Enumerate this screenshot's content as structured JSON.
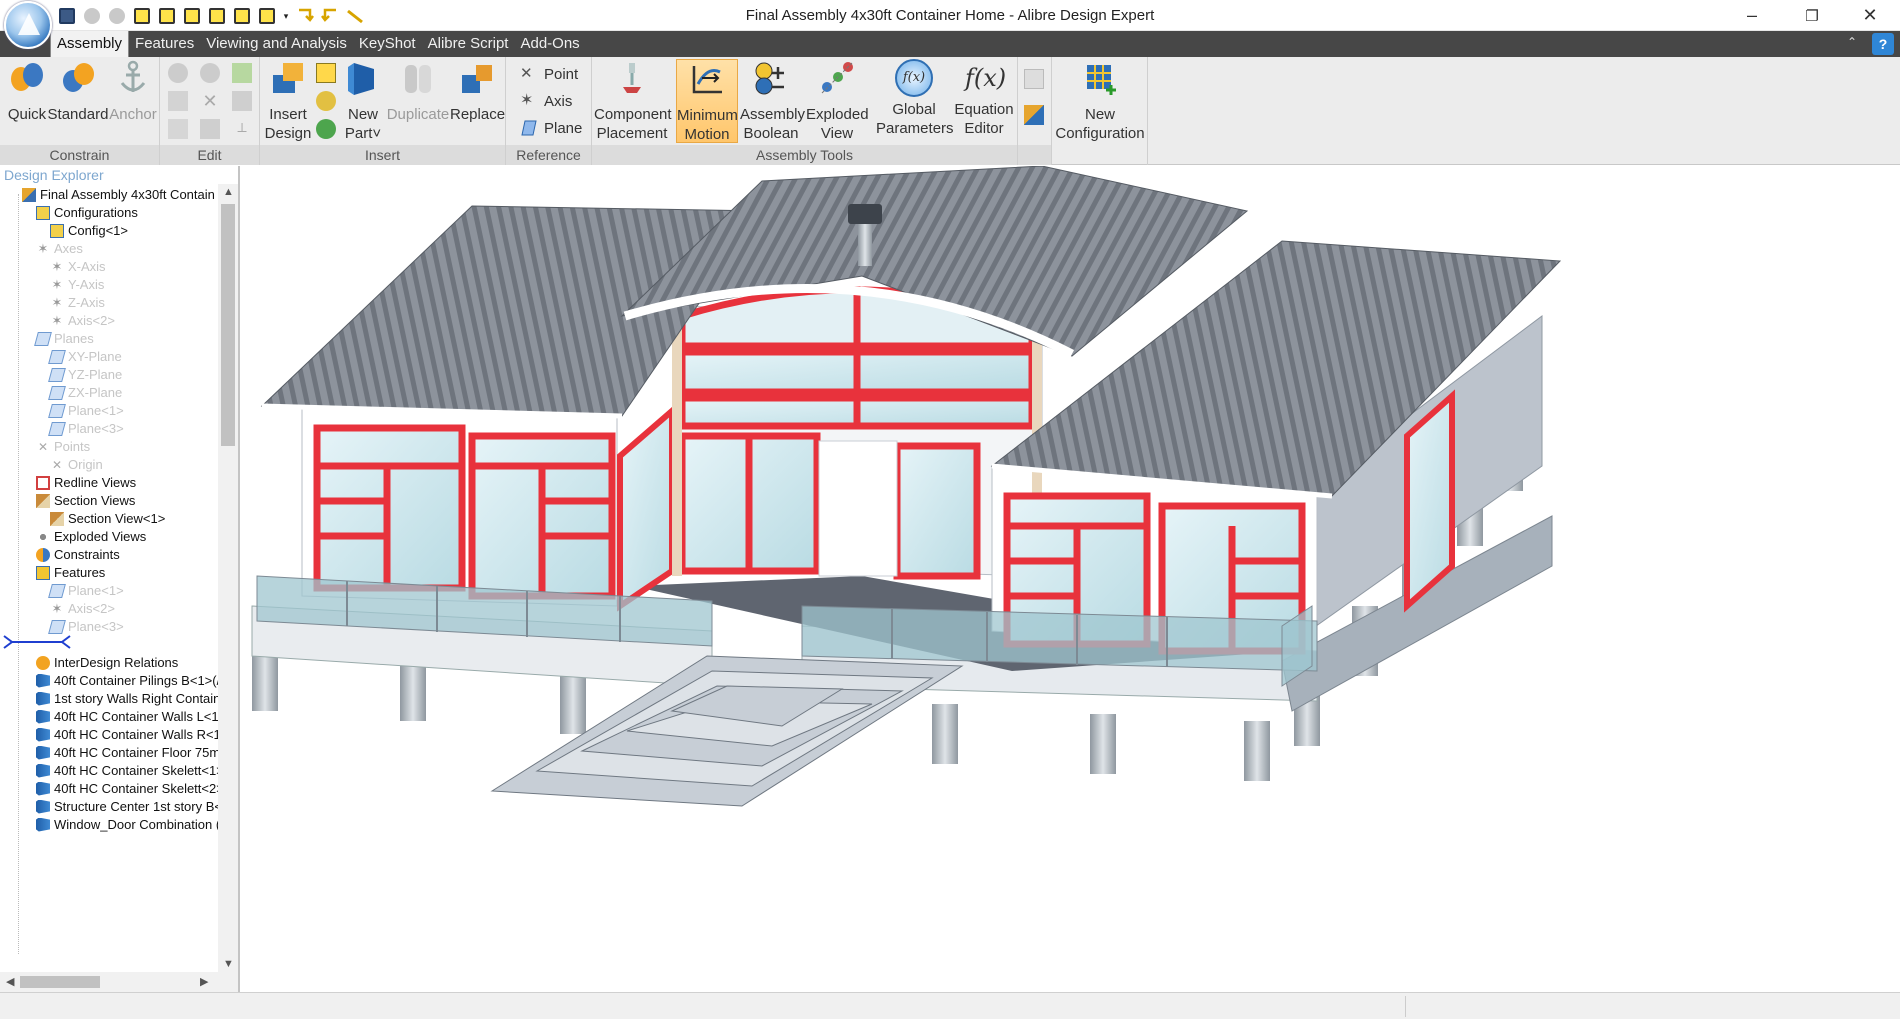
{
  "window": {
    "title": "Final Assembly 4x30ft Container Home - Alibre Design Expert",
    "minimize": "–",
    "restore": "❐",
    "close": "✕"
  },
  "quick_access": [
    "save-icon",
    "undo-icon",
    "redo-icon",
    "cube-icon",
    "cube-icon",
    "cube-icon",
    "cube-icon",
    "cube-icon",
    "cube-icon",
    "arrow-icon",
    "arrow-icon",
    "pen-icon"
  ],
  "tabs": [
    {
      "label": "Assembly",
      "active": true
    },
    {
      "label": "Features"
    },
    {
      "label": "Viewing and Analysis"
    },
    {
      "label": "KeyShot"
    },
    {
      "label": "Alibre Script"
    },
    {
      "label": "Add-Ons"
    }
  ],
  "help_label": "?",
  "collapse_glyph": "⌃",
  "ribbon": {
    "constrain": {
      "label": "Constrain",
      "quick": "Quick",
      "standard": "Standard",
      "anchor": "Anchor"
    },
    "edit": {
      "label": "Edit"
    },
    "insert": {
      "label": "Insert",
      "insert_design_1": "Insert",
      "insert_design_2": "Design",
      "new_part_1": "New",
      "new_part_2": "Part˅",
      "duplicate": "Duplicate",
      "replace": "Replace"
    },
    "reference": {
      "label": "Reference",
      "point": "Point",
      "axis": "Axis",
      "plane": "Plane"
    },
    "assembly_tools": {
      "label": "Assembly Tools",
      "component_placement_1": "Component",
      "component_placement_2": "Placement",
      "minimum_motion_1": "Minimum",
      "minimum_motion_2": "Motion",
      "assembly_boolean_1": "Assembly",
      "assembly_boolean_2": "Boolean",
      "exploded_view_1": "Exploded",
      "exploded_view_2": "View",
      "global_parameters_1": "Global",
      "global_parameters_2": "Parameters",
      "equation_editor_1": "Equation",
      "equation_editor_2": "Editor",
      "fx_glyph": "f(x)",
      "fx_small": "f(x)"
    },
    "configuration": {
      "new_1": "New",
      "new_2": "Configuration"
    }
  },
  "explorer": {
    "title": "Design Explorer",
    "nodes": [
      {
        "label": "Final Assembly 4x30ft Contain",
        "indent": 1,
        "icon": "assembly-icon",
        "dim": false
      },
      {
        "label": "Configurations",
        "indent": 2,
        "icon": "config-icon",
        "dim": false
      },
      {
        "label": "Config<1>",
        "indent": 3,
        "icon": "config-icon",
        "dim": false
      },
      {
        "label": "Axes",
        "indent": 2,
        "icon": "axis-icon",
        "dim": true
      },
      {
        "label": "X-Axis",
        "indent": 3,
        "icon": "axis-icon",
        "dim": true
      },
      {
        "label": "Y-Axis",
        "indent": 3,
        "icon": "axis-icon",
        "dim": true
      },
      {
        "label": "Z-Axis",
        "indent": 3,
        "icon": "axis-icon",
        "dim": true
      },
      {
        "label": "Axis<2>",
        "indent": 3,
        "icon": "axis-icon",
        "dim": true
      },
      {
        "label": "Planes",
        "indent": 2,
        "icon": "plane-icon",
        "dim": true
      },
      {
        "label": "XY-Plane",
        "indent": 3,
        "icon": "plane-icon",
        "dim": true
      },
      {
        "label": "YZ-Plane",
        "indent": 3,
        "icon": "plane-icon",
        "dim": true
      },
      {
        "label": "ZX-Plane",
        "indent": 3,
        "icon": "plane-icon",
        "dim": true
      },
      {
        "label": "Plane<1>",
        "indent": 3,
        "icon": "plane-icon",
        "dim": true
      },
      {
        "label": "Plane<3>",
        "indent": 3,
        "icon": "plane-icon",
        "dim": true
      },
      {
        "label": "Points",
        "indent": 2,
        "icon": "point-icon",
        "dim": true
      },
      {
        "label": "Origin",
        "indent": 3,
        "icon": "point-icon",
        "dim": true
      },
      {
        "label": "Redline Views",
        "indent": 2,
        "icon": "redline-icon",
        "dim": false
      },
      {
        "label": "Section Views",
        "indent": 2,
        "icon": "section-icon",
        "dim": false
      },
      {
        "label": "Section View<1>",
        "indent": 3,
        "icon": "section-icon",
        "dim": false
      },
      {
        "label": "Exploded Views",
        "indent": 2,
        "icon": "exploded-icon",
        "dim": false
      },
      {
        "label": "Constraints",
        "indent": 2,
        "icon": "constraint-icon",
        "dim": false
      },
      {
        "label": "Features",
        "indent": 2,
        "icon": "feature-icon",
        "dim": false
      },
      {
        "label": "Plane<1>",
        "indent": 3,
        "icon": "plane-icon",
        "dim": true
      },
      {
        "label": "Axis<2>",
        "indent": 3,
        "icon": "axis-icon",
        "dim": true
      },
      {
        "label": "Plane<3>",
        "indent": 3,
        "icon": "plane-icon",
        "dim": true
      },
      {
        "label": "",
        "indent": 1,
        "icon": "rollback-marker-icon",
        "dim": false
      },
      {
        "label": "InterDesign Relations",
        "indent": 2,
        "icon": "relation-icon",
        "dim": false
      },
      {
        "label": "40ft Container Pilings B<1>(/",
        "indent": 2,
        "icon": "part-icon",
        "dim": false
      },
      {
        "label": "1st story Walls Right Contain",
        "indent": 2,
        "icon": "part-icon",
        "dim": false
      },
      {
        "label": "40ft HC Container Walls L<1:",
        "indent": 2,
        "icon": "part-icon",
        "dim": false
      },
      {
        "label": "40ft HC Container Walls R<1",
        "indent": 2,
        "icon": "part-icon",
        "dim": false
      },
      {
        "label": "40ft HC Container Floor 75m",
        "indent": 2,
        "icon": "part-icon",
        "dim": false
      },
      {
        "label": "40ft HC Container Skelett<1>",
        "indent": 2,
        "icon": "part-icon",
        "dim": false
      },
      {
        "label": "40ft HC Container Skelett<2>",
        "indent": 2,
        "icon": "part-icon",
        "dim": false
      },
      {
        "label": "Structure Center 1st story B<",
        "indent": 2,
        "icon": "part-icon",
        "dim": false
      },
      {
        "label": "Window_Door Combination (",
        "indent": 2,
        "icon": "part-icon",
        "dim": false
      }
    ]
  },
  "colors": {
    "accent": "#2f86d6",
    "tab_bar": "#474747",
    "ribbon": "#ececec",
    "frame_red": "#e8323c",
    "roof": "#8a8f98",
    "glass": "#cfe8ee"
  }
}
